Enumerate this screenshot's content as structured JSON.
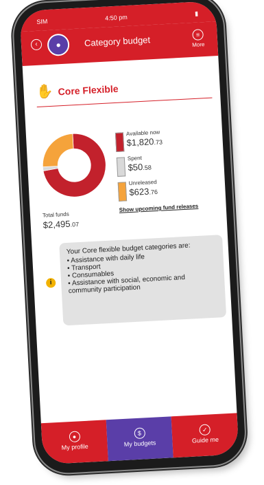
{
  "statusbar": {
    "carrier": "SIM",
    "time": "4:50 pm"
  },
  "header": {
    "title": "Category budget",
    "more_label": "More"
  },
  "section": {
    "title": "Core Flexible"
  },
  "donut": {
    "chart_data": {
      "type": "pie",
      "slices": [
        {
          "label": "Available now",
          "value": 1820.73,
          "color": "#c2212c"
        },
        {
          "label": "Spent",
          "value": 50.58,
          "color": "#d9d9d9"
        },
        {
          "label": "Unreleased",
          "value": 623.76,
          "color": "#f5a33b"
        }
      ]
    }
  },
  "legend": {
    "available": {
      "label": "Available now",
      "amount_main": "$1,820",
      "amount_cents": ".73"
    },
    "spent": {
      "label": "Spent",
      "amount_main": "$50",
      "amount_cents": ".58"
    },
    "unreleased": {
      "label": "Unreleased",
      "amount_main": "$623",
      "amount_cents": ".76"
    }
  },
  "total": {
    "label": "Total funds",
    "amount_main": "$2,495",
    "amount_cents": ".07"
  },
  "fund_link": "Show upcoming fund releases",
  "info": {
    "intro": "Your Core flexible budget categories are:",
    "items": [
      "Assistance with daily life",
      "Transport",
      "Consumables",
      "Assistance with social, economic and community participation"
    ]
  },
  "tabs": [
    {
      "label": "My profile"
    },
    {
      "label": "My budgets"
    },
    {
      "label": "Guide me"
    }
  ],
  "colors": {
    "brand_red": "#d51f28",
    "brand_purple": "#5a3ea8",
    "info_yellow": "#f2b200"
  }
}
